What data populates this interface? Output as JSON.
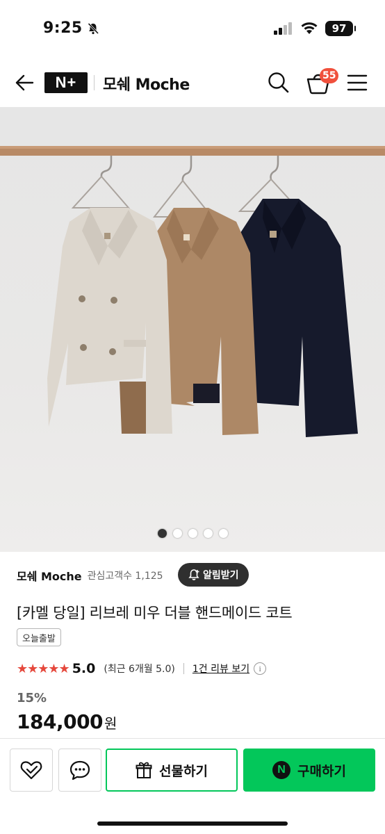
{
  "status_bar": {
    "time": "9:25",
    "battery": "97"
  },
  "header": {
    "logo": "N+",
    "store_name": "모쉐 Moche",
    "cart_count": "55"
  },
  "product_image": {
    "slide_count": 5,
    "active_slide": 1
  },
  "store": {
    "name": "모쉐 Moche",
    "followers": "관심고객수 1,125",
    "alert_button": "알림받기"
  },
  "product": {
    "title": "[카멜 당일] 리브레 미우 더블 핸드메이드 코트",
    "tag": "오늘출발",
    "stars": "★★★★★",
    "rating": "5.0",
    "recent_rating": "(최근 6개월 5.0)",
    "review_link": "1건 리뷰 보기",
    "discount": "15%",
    "price": "184,000",
    "price_unit": "원"
  },
  "actions": {
    "gift_label": "선물하기",
    "buy_label": "구매하기",
    "buy_badge": "N"
  },
  "colors": {
    "accent_green": "#03c75a",
    "badge_red": "#f0503c",
    "star_red": "#e5483c"
  }
}
